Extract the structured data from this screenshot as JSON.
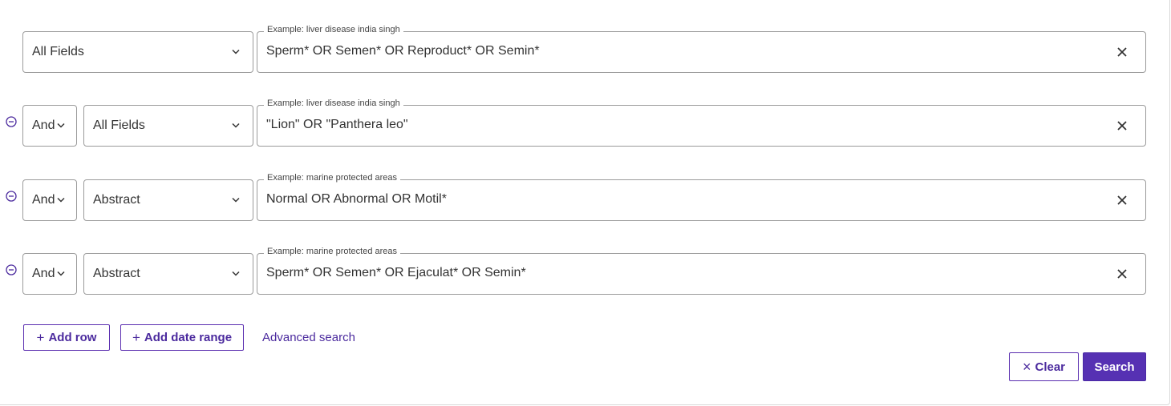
{
  "rows": [
    {
      "operator": null,
      "field": "All Fields",
      "placeholder_label": "Example: liver disease india singh",
      "query": "Sperm* OR Semen* OR Reproduct* OR Semin*"
    },
    {
      "operator": "And",
      "field": "All Fields",
      "placeholder_label": "Example: liver disease india singh",
      "query": "\"Lion\" OR \"Panthera leo\""
    },
    {
      "operator": "And",
      "field": "Abstract",
      "placeholder_label": "Example: marine protected areas",
      "query": "Normal OR Abnormal OR Motil*"
    },
    {
      "operator": "And",
      "field": "Abstract",
      "placeholder_label": "Example: marine protected areas",
      "query": "Sperm* OR Semen* OR Ejaculat* OR Semin*"
    }
  ],
  "actions": {
    "add_row": {
      "icon": "+",
      "label": "Add row"
    },
    "add_date_range": {
      "icon": "+",
      "label": "Add date range"
    },
    "advanced_search": "Advanced search",
    "clear": {
      "icon": "×",
      "label": "Clear"
    },
    "search": "Search"
  },
  "icons": {
    "remove_row": "minus-circle-icon",
    "dropdown": "chevron-down-icon",
    "clear_field": "close-icon"
  },
  "colors": {
    "accent": "#5631b3",
    "accent_text": "#4b2a9e",
    "border": "#9b9b9b"
  }
}
